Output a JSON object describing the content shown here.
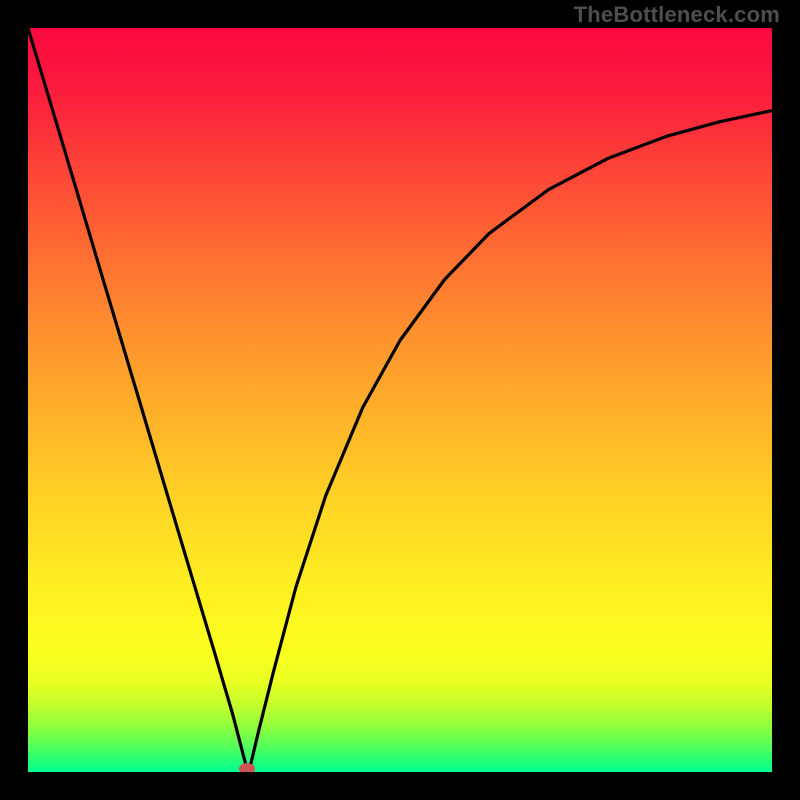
{
  "watermark": "TheBottleneck.com",
  "colors": {
    "frame": "#000000",
    "curve": "#000000",
    "marker": "#cf5252",
    "gradient": [
      "#f9083f",
      "#fb1b3d",
      "#fd4737",
      "#fe7432",
      "#ff9a2d",
      "#ffba29",
      "#ffd425",
      "#fee822",
      "#fdf620",
      "#faff1f",
      "#e8ff22",
      "#c3ff2c",
      "#8dff3e",
      "#49ff60",
      "#00ff92"
    ]
  },
  "chart_data": {
    "type": "line",
    "title": "",
    "xlabel": "",
    "ylabel": "",
    "xlim": [
      0,
      1
    ],
    "ylim": [
      0,
      1
    ],
    "grid": false,
    "legend": false,
    "marker_position": {
      "x": 0.295,
      "y": 0.0
    },
    "series": [
      {
        "name": "dip-curve",
        "points": [
          {
            "x": 0.0,
            "y": 1.0
          },
          {
            "x": 0.05,
            "y": 0.833
          },
          {
            "x": 0.1,
            "y": 0.665
          },
          {
            "x": 0.15,
            "y": 0.498
          },
          {
            "x": 0.2,
            "y": 0.33
          },
          {
            "x": 0.25,
            "y": 0.163
          },
          {
            "x": 0.275,
            "y": 0.078
          },
          {
            "x": 0.292,
            "y": 0.013
          },
          {
            "x": 0.295,
            "y": 0.0
          },
          {
            "x": 0.3,
            "y": 0.013
          },
          {
            "x": 0.31,
            "y": 0.055
          },
          {
            "x": 0.33,
            "y": 0.135
          },
          {
            "x": 0.36,
            "y": 0.248
          },
          {
            "x": 0.4,
            "y": 0.371
          },
          {
            "x": 0.45,
            "y": 0.49
          },
          {
            "x": 0.5,
            "y": 0.58
          },
          {
            "x": 0.56,
            "y": 0.662
          },
          {
            "x": 0.62,
            "y": 0.724
          },
          {
            "x": 0.7,
            "y": 0.783
          },
          {
            "x": 0.78,
            "y": 0.825
          },
          {
            "x": 0.86,
            "y": 0.855
          },
          {
            "x": 0.93,
            "y": 0.874
          },
          {
            "x": 1.0,
            "y": 0.889
          }
        ]
      }
    ]
  }
}
